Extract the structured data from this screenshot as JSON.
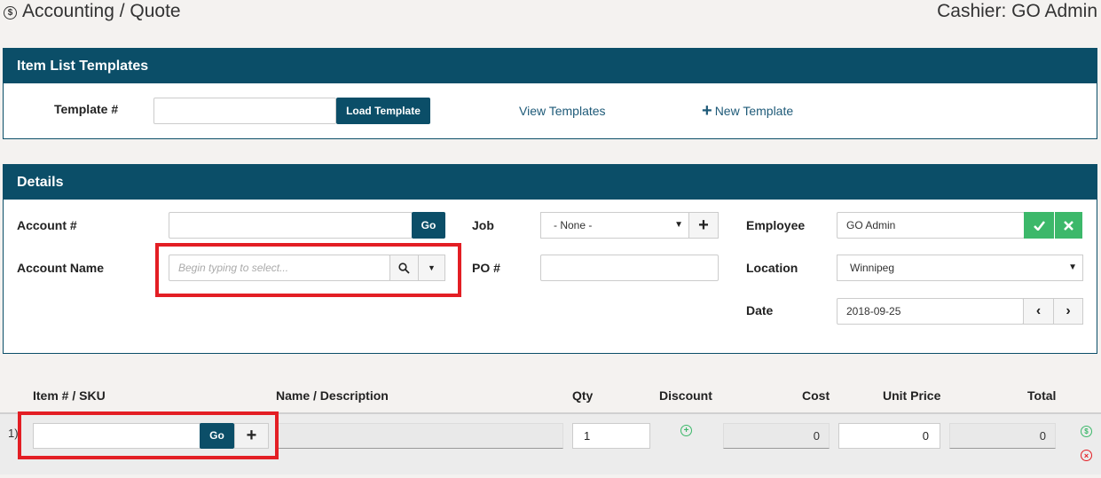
{
  "header": {
    "title": "Accounting / Quote",
    "cashier": "Cashier: GO Admin",
    "title_icon": "dollar-circle-icon"
  },
  "templates_panel": {
    "heading": "Item List Templates",
    "template_label": "Template #",
    "template_value": "",
    "load_button": "Load Template",
    "view_link": "View Templates",
    "new_link": "New Template",
    "new_icon": "plus-icon"
  },
  "details_panel": {
    "heading": "Details",
    "account_label": "Account #",
    "account_value": "",
    "account_go": "Go",
    "account_name_label": "Account Name",
    "account_name_placeholder": "Begin typing to select...",
    "job_label": "Job",
    "job_selected": "- None -",
    "po_label": "PO #",
    "po_value": "",
    "employee_label": "Employee",
    "employee_value": "GO Admin",
    "location_label": "Location",
    "location_selected": "Winnipeg",
    "date_label": "Date",
    "date_value": "2018-09-25"
  },
  "items_table": {
    "columns": [
      "Item # / SKU",
      "Name / Description",
      "Qty",
      "Discount",
      "Cost",
      "Unit Price",
      "Total"
    ],
    "rows": [
      {
        "index": "1)",
        "sku": "",
        "go_label": "Go",
        "name": "",
        "qty": "1",
        "cost": "0",
        "unit_price": "0",
        "total": "0"
      }
    ]
  },
  "colors": {
    "brand": "#0b4e68",
    "success": "#3cb86a",
    "danger": "#e31e24",
    "highlight": "#e31e24"
  }
}
